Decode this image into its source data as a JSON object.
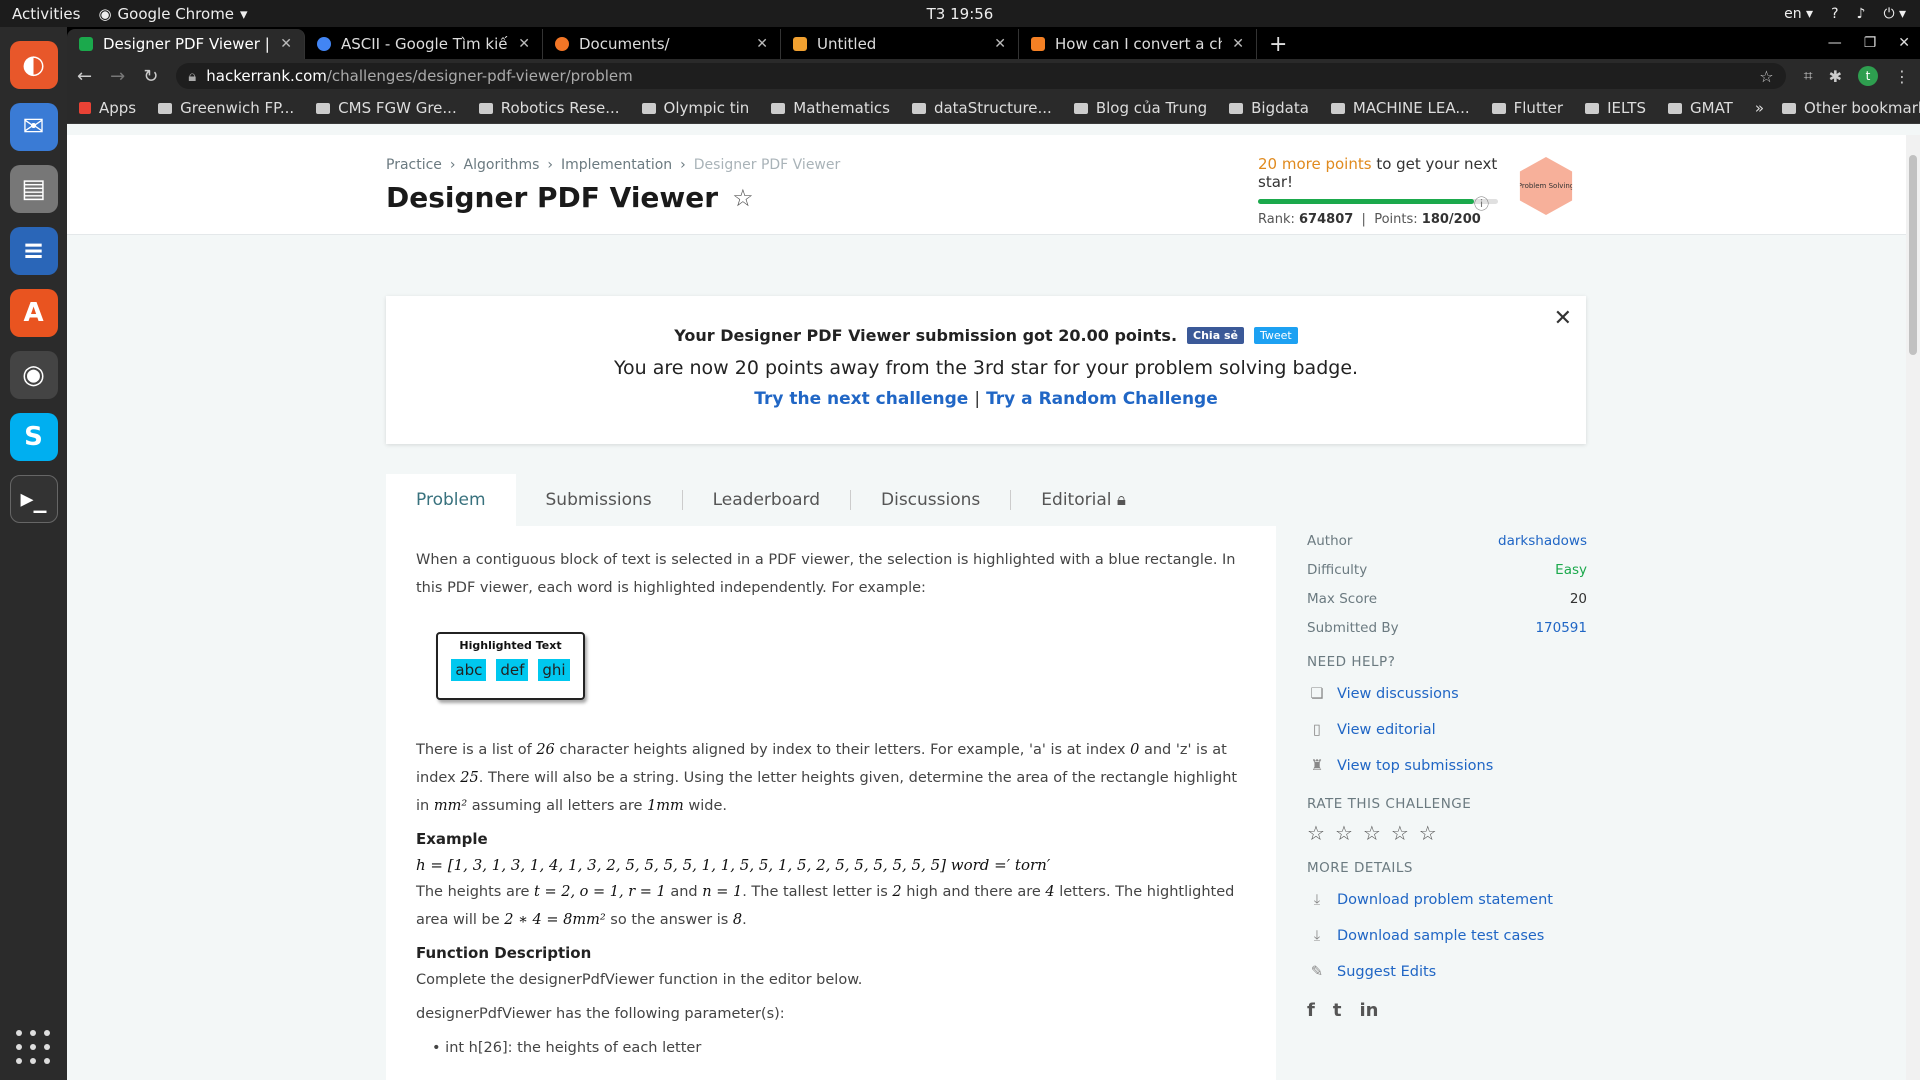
{
  "topbar": {
    "activities": "Activities",
    "app_name": "Google Chrome",
    "clock": "T3 19:56",
    "lang": "en"
  },
  "tabs": [
    {
      "title": "Designer PDF Viewer | Ha"
    },
    {
      "title": "ASCII - Google Tìm kiếm"
    },
    {
      "title": "Documents/"
    },
    {
      "title": "Untitled"
    },
    {
      "title": "How can I convert a chara"
    }
  ],
  "address": {
    "host": "hackerrank.com",
    "path": "/challenges/designer-pdf-viewer/problem",
    "avatar": "t"
  },
  "bookmarks": [
    "Apps",
    "Greenwich FP...",
    "CMS FGW Gre...",
    "Robotics Rese...",
    "Olympic tin",
    "Mathematics",
    "dataStructure...",
    "Blog của Trung",
    "Bigdata",
    "MACHINE LEA...",
    "Flutter",
    "IELTS",
    "GMAT"
  ],
  "bookmarks_more": "»",
  "other_bookmarks": "Other bookmarks",
  "breadcrumb": [
    "Practice",
    "Algorithms",
    "Implementation",
    "Designer PDF Viewer"
  ],
  "page_title": "Designer PDF Viewer",
  "progress": {
    "more_points": "20 more points",
    "suffix": " to get your next star!",
    "fill_fraction": 0.9,
    "rank_label": "Rank:",
    "rank": "674807",
    "points_label": "Points:",
    "points": "180/200",
    "badge_text": "Problem Solving"
  },
  "notice": {
    "line1": "Your Designer PDF Viewer submission got 20.00 points.",
    "fb": "Chia sẻ",
    "tweet": "Tweet",
    "line2": "You are now 20 points away from the 3rd star for your problem solving badge.",
    "next": "Try the next challenge",
    "sep": "|",
    "random": "Try a Random Challenge"
  },
  "problem_tabs": [
    "Problem",
    "Submissions",
    "Leaderboard",
    "Discussions",
    "Editorial"
  ],
  "content": {
    "intro": "When a contiguous block of text is selected in a PDF viewer, the selection is highlighted with a blue rectangle. In this PDF viewer, each word is highlighted independently. For example:",
    "hl_title": "Highlighted Text",
    "hl_words": [
      "abc",
      "def",
      "ghi"
    ],
    "p2_a": "There is a list of ",
    "p2_26": "26",
    "p2_b": " character heights aligned by index to their letters. For example, 'a' is at index ",
    "p2_0": "0",
    "p2_c": " and 'z' is at index ",
    "p2_25": "25",
    "p2_d": ". There will also be a string. Using the letter heights given, determine the area of the rectangle highlight in ",
    "p2_mm2": "mm²",
    "p2_e": " assuming all letters are ",
    "p2_1mm": "1mm",
    "p2_f": " wide.",
    "example_h": "Example",
    "example_math": "h = [1, 3, 1, 3, 1, 4, 1, 3, 2, 5, 5, 5, 5, 1, 1, 5, 5, 1, 5, 2, 5, 5, 5, 5, 5, 5]  word =′ torn′",
    "p3_a": "The heights are ",
    "p3_m1": "t = 2, o = 1, r = 1",
    "p3_b": " and ",
    "p3_m2": "n = 1",
    "p3_c": ". The tallest letter is ",
    "p3_m3": "2",
    "p3_d": " high and there are ",
    "p3_m4": "4",
    "p3_e": " letters. The hightlighted area will be ",
    "p3_m5": "2 ∗ 4 = 8mm²",
    "p3_f": " so the answer is ",
    "p3_m6": "8",
    "p3_g": ".",
    "fd_h": "Function Description",
    "fd_p": "Complete the designerPdfViewer function in the editor below.",
    "fd_p2": "designerPdfViewer has the following parameter(s):",
    "fd_li": "int h[26]: the heights of each letter"
  },
  "sidebar": {
    "author_k": "Author",
    "author_v": "darkshadows",
    "difficulty_k": "Difficulty",
    "difficulty_v": "Easy",
    "maxscore_k": "Max Score",
    "maxscore_v": "20",
    "submitted_k": "Submitted By",
    "submitted_v": "170591",
    "need_help": "NEED HELP?",
    "help": [
      "View discussions",
      "View editorial",
      "View top submissions"
    ],
    "rate": "RATE THIS CHALLENGE",
    "more": "MORE DETAILS",
    "details": [
      "Download problem statement",
      "Download sample test cases",
      "Suggest Edits"
    ]
  }
}
